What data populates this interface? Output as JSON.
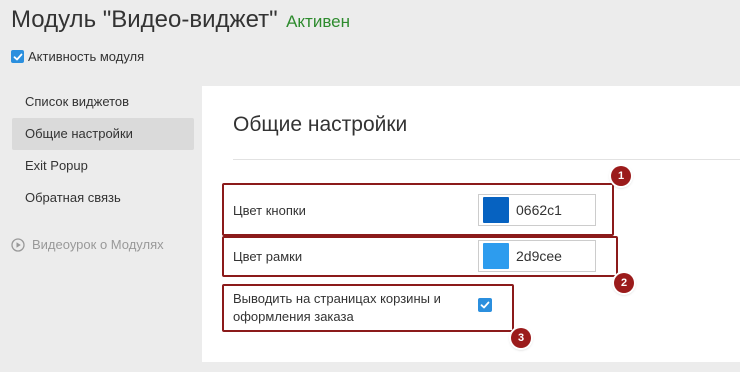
{
  "header": {
    "title": "Модуль \"Видео-виджет\"",
    "status": "Активен",
    "status_color": "#2e8b2e"
  },
  "module_active": {
    "label": "Активность модуля",
    "checked": true
  },
  "sidebar": {
    "items": [
      {
        "label": "Список виджетов",
        "active": false
      },
      {
        "label": "Общие настройки",
        "active": true
      },
      {
        "label": "Exit Popup",
        "active": false
      },
      {
        "label": "Обратная связь",
        "active": false
      }
    ],
    "video_link": {
      "label": "Видеоурок о Модулях",
      "icon": "play-circle-icon"
    }
  },
  "panel": {
    "title": "Общие настройки",
    "fields": {
      "button_color": {
        "label": "Цвет кнопки",
        "value": "0662c1",
        "swatch": "#0662c1"
      },
      "border_color": {
        "label": "Цвет рамки",
        "value": "2d9cee",
        "swatch": "#2d9cee"
      },
      "show_in_cart": {
        "label_line1": "Выводить на страницах корзины и",
        "label_line2": "оформления заказа",
        "checked": true
      }
    }
  },
  "annotations": {
    "badge1": "1",
    "badge2": "2",
    "badge3": "3",
    "color": "#8b1a1a"
  }
}
